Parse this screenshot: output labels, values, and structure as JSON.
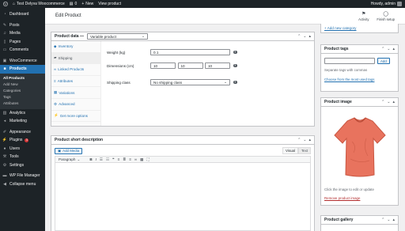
{
  "adminbar": {
    "site_name": "Test Delyva Woocommerce",
    "comments_count": "0",
    "new_label": "New",
    "view_label": "View product",
    "howdy": "Howdy, admin"
  },
  "sidebar": {
    "dashboard": "Dashboard",
    "posts": "Posts",
    "media": "Media",
    "pages": "Pages",
    "comments": "Comments",
    "woocommerce": "WooCommerce",
    "products": "Products",
    "sub_items": [
      "All Products",
      "Add New",
      "Categories",
      "Tags",
      "Attributes"
    ],
    "analytics": "Analytics",
    "marketing": "Marketing",
    "appearance": "Appearance",
    "plugins": "Plugins",
    "plugins_badge": "3",
    "users": "Users",
    "tools": "Tools",
    "settings": "Settings",
    "wp_file_manager": "WP File Manager",
    "collapse": "Collapse menu"
  },
  "topbar": {
    "title": "Edit Product",
    "activity": "Activity",
    "finish_setup": "Finish setup"
  },
  "product_data": {
    "title": "Product data —",
    "type_value": "Variable product",
    "tabs": [
      "Inventory",
      "Shipping",
      "Linked Products",
      "Attributes",
      "Variations",
      "Advanced",
      "Get more options"
    ],
    "weight_label": "Weight (kg)",
    "weight_value": "0.1",
    "dimensions_label": "Dimensions (cm)",
    "length": "10",
    "width": "10",
    "height": "10",
    "shipping_class_label": "Shipping class",
    "shipping_class_value": "No shipping class"
  },
  "short_desc": {
    "title": "Product short description",
    "add_media": "Add Media",
    "visual_tab": "Visual",
    "text_tab": "Text",
    "format_value": "Paragraph"
  },
  "right": {
    "add_category_link": "+ Add new category",
    "tags_title": "Product tags",
    "add_button": "Add",
    "tags_hint": "Separate tags with commas",
    "choose_tags_link": "Choose from the most used tags",
    "image_title": "Product image",
    "image_hint": "Click the image to edit or update",
    "remove_image_link": "Remove product image",
    "gallery_title": "Product gallery"
  }
}
